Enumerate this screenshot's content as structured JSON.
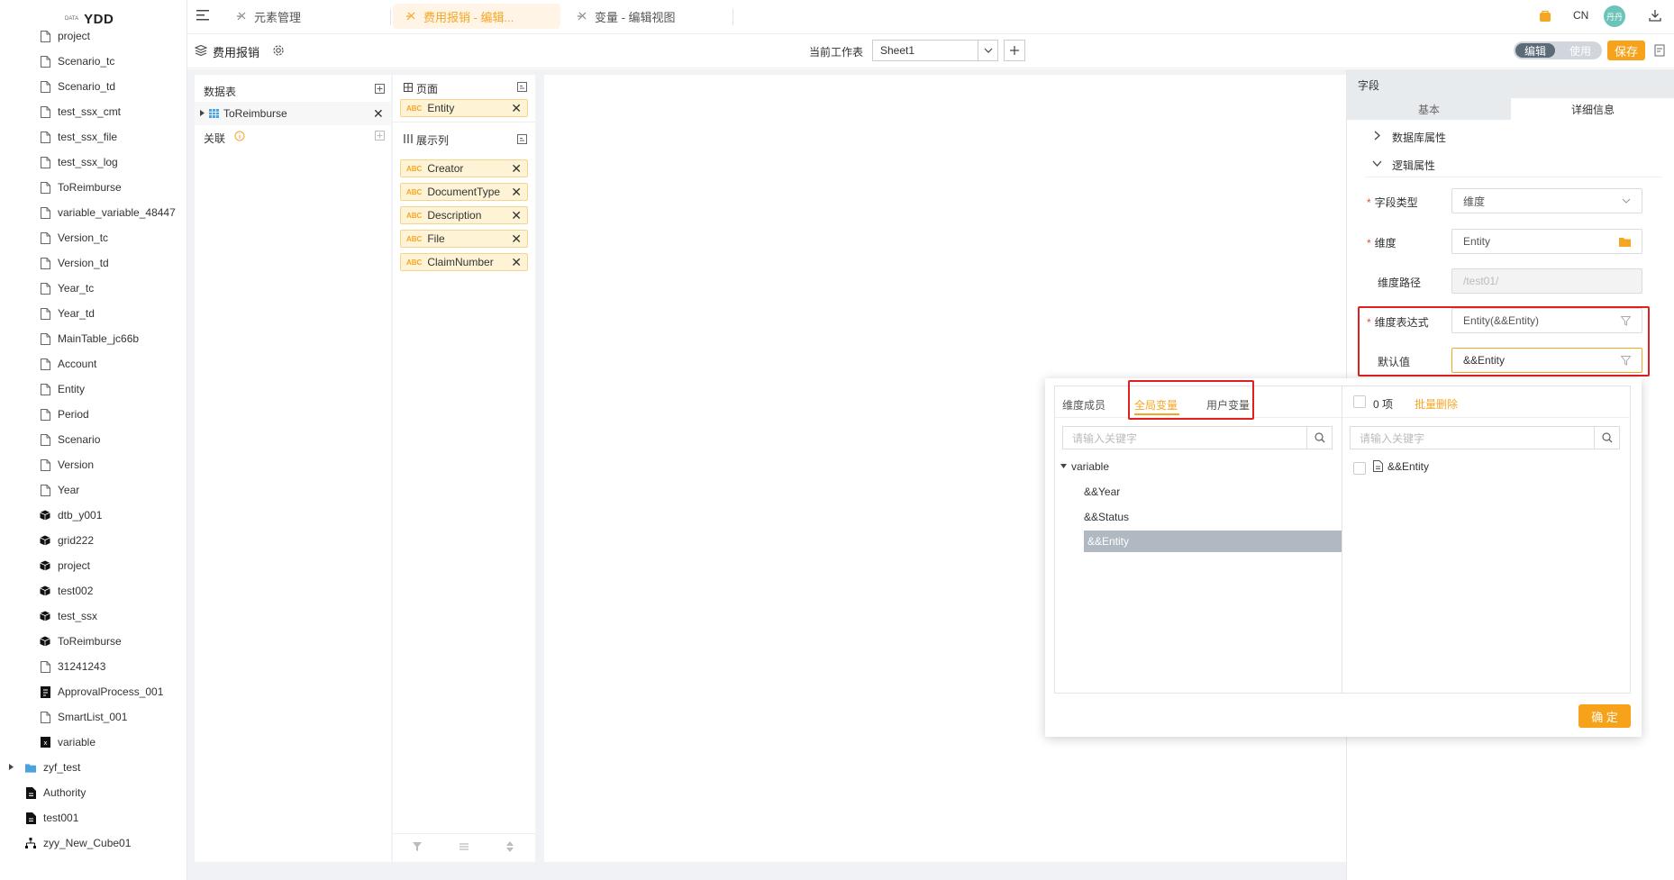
{
  "app": {
    "logo_small": "DATA",
    "logo_name": "YDD"
  },
  "sidebar": {
    "items": [
      {
        "label": "project",
        "icon": "file-icon"
      },
      {
        "label": "Scenario_tc",
        "icon": "file-icon"
      },
      {
        "label": "Scenario_td",
        "icon": "file-icon"
      },
      {
        "label": "test_ssx_cmt",
        "icon": "file-icon"
      },
      {
        "label": "test_ssx_file",
        "icon": "file-icon"
      },
      {
        "label": "test_ssx_log",
        "icon": "file-icon"
      },
      {
        "label": "ToReimburse",
        "icon": "file-icon"
      },
      {
        "label": "variable_variable_48447",
        "icon": "file-icon"
      },
      {
        "label": "Version_tc",
        "icon": "file-icon"
      },
      {
        "label": "Version_td",
        "icon": "file-icon"
      },
      {
        "label": "Year_tc",
        "icon": "file-icon"
      },
      {
        "label": "Year_td",
        "icon": "file-icon"
      },
      {
        "label": "MainTable_jc66b",
        "icon": "file-icon"
      },
      {
        "label": "Account",
        "icon": "file-icon"
      },
      {
        "label": "Entity",
        "icon": "file-icon"
      },
      {
        "label": "Period",
        "icon": "file-icon"
      },
      {
        "label": "Scenario",
        "icon": "file-icon"
      },
      {
        "label": "Version",
        "icon": "file-icon"
      },
      {
        "label": "Year",
        "icon": "file-icon"
      },
      {
        "label": "dtb_y001",
        "icon": "cube-icon"
      },
      {
        "label": "grid222",
        "icon": "cube-icon"
      },
      {
        "label": "project",
        "icon": "cube-icon"
      },
      {
        "label": "test002",
        "icon": "cube-icon"
      },
      {
        "label": "test_ssx",
        "icon": "cube-icon"
      },
      {
        "label": "ToReimburse",
        "icon": "cube-icon"
      },
      {
        "label": "31241243",
        "icon": "file-icon"
      },
      {
        "label": "ApprovalProcess_001",
        "icon": "process-icon"
      },
      {
        "label": "SmartList_001",
        "icon": "file-icon"
      },
      {
        "label": "variable",
        "icon": "variable-icon"
      }
    ],
    "root_items": [
      {
        "label": "zyf_test",
        "icon": "folder-icon"
      },
      {
        "label": "Authority",
        "icon": "doc-dark-icon"
      },
      {
        "label": "test001",
        "icon": "doc-dark-icon"
      },
      {
        "label": "zyy_New_Cube01",
        "icon": "hierarchy-icon"
      }
    ]
  },
  "tabs": [
    {
      "label": "元素管理",
      "icon": "element-icon"
    },
    {
      "label": "费用报销 - 编辑...",
      "icon": "element-icon"
    },
    {
      "label": "变量 - 编辑视图",
      "icon": "element-icon"
    }
  ],
  "header": {
    "lang": "CN",
    "avatar": "丹丹"
  },
  "toolbar": {
    "title": "费用报销",
    "sheet_label": "当前工作表",
    "sheet_value": "Sheet1",
    "mode_edit": "编辑",
    "mode_use": "使用",
    "save": "保存"
  },
  "datatable_panel": {
    "title": "数据表",
    "item": "ToReimburse",
    "relation": "关联"
  },
  "page_panel": {
    "title": "页面",
    "chips": [
      "Entity"
    ]
  },
  "display_panel": {
    "title": "展示列",
    "chips": [
      "Creator",
      "DocumentType",
      "Description",
      "File",
      "ClaimNumber"
    ],
    "chip_tag": "ABC"
  },
  "right_panel": {
    "title": "字段",
    "tab_basic": "基本",
    "tab_detail": "详细信息",
    "section_db": "数据库属性",
    "section_logic": "逻辑属性",
    "field_type_label": "字段类型",
    "field_type_value": "维度",
    "dimension_label": "维度",
    "dimension_value": "Entity",
    "dim_path_label": "维度路径",
    "dim_path_value": "/test01/",
    "dim_expr_label": "维度表达式",
    "dim_expr_value": "Entity(&&Entity)",
    "default_label": "默认值",
    "default_value": "&&Entity"
  },
  "popup": {
    "tab_members": "维度成员",
    "tab_global": "全局变量",
    "tab_user": "用户变量",
    "search_placeholder": "请输入关键字",
    "tree_root": "variable",
    "tree_items": [
      "&&Year",
      "&&Status",
      "&&Entity"
    ],
    "count": "0 项",
    "batch_delete": "批量删除",
    "right_search_placeholder": "请输入关键字",
    "selected_items": [
      "&&Entity"
    ],
    "confirm": "确 定"
  },
  "colors": {
    "accent": "#f7a21b",
    "highlight_row": "#b0b8c1",
    "chip_bg": "#fff3d6",
    "annotation_red": "#e02020"
  }
}
